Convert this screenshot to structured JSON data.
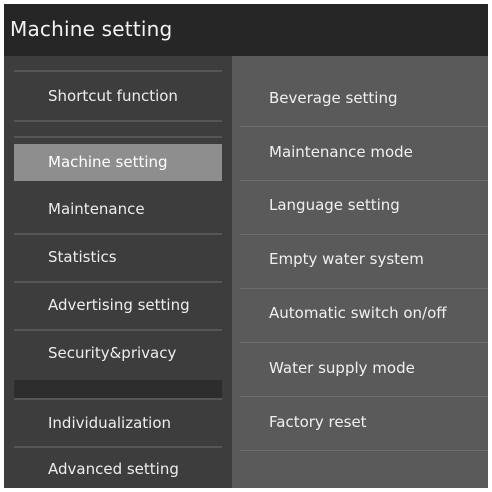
{
  "window": {
    "title": "Machine setting"
  },
  "sidebar": {
    "items": [
      {
        "label": "Shortcut function"
      },
      {
        "label": "Machine setting",
        "active": true
      },
      {
        "label": "Maintenance"
      },
      {
        "label": "Statistics"
      },
      {
        "label": "Advertising setting"
      },
      {
        "label": "Security&privacy"
      },
      {
        "label": "Individualization"
      },
      {
        "label": "Advanced setting"
      }
    ]
  },
  "main": {
    "items": [
      {
        "label": "Beverage setting"
      },
      {
        "label": "Maintenance mode"
      },
      {
        "label": "Language setting"
      },
      {
        "label": "Empty water system"
      },
      {
        "label": "Automatic switch on/off"
      },
      {
        "label": "Water supply mode"
      },
      {
        "label": "Factory reset"
      }
    ]
  },
  "colors": {
    "title_bar": "#262626",
    "sidebar": "#3d3d3d",
    "main": "#5a5a5a",
    "active_item": "#8e8e8e"
  }
}
